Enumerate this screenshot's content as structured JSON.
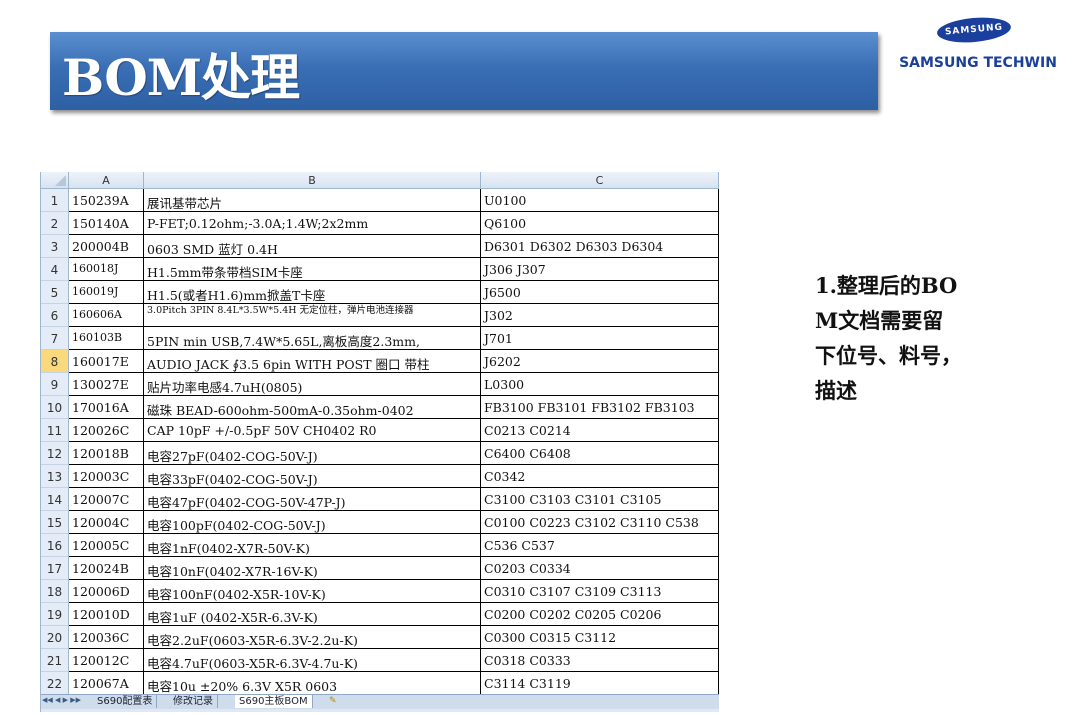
{
  "slide": {
    "title": "BOM处理",
    "logo": {
      "mark": "SAMSUNG",
      "text": "SAMSUNG TECHWIN"
    },
    "note_lines": [
      "1.整理后的BO",
      "M文档需要留",
      "下位号、料号，",
      "描述"
    ]
  },
  "spreadsheet": {
    "columns": [
      "A",
      "B",
      "C"
    ],
    "selected_row": 8,
    "rows": [
      {
        "n": "1",
        "a": "150239A",
        "b": "展讯基带芯片",
        "c": "U0100"
      },
      {
        "n": "2",
        "a": "150140A",
        "b": "P-FET;0.12ohm;-3.0A;1.4W;2x2mm",
        "c": "Q6100"
      },
      {
        "n": "3",
        "a": "200004B",
        "b": "0603 SMD 蓝灯 0.4H",
        "c": "D6301 D6302 D6303 D6304"
      },
      {
        "n": "4",
        "a": "160018J",
        "b": "H1.5mm带条带档SIM卡座",
        "c": "J306 J307"
      },
      {
        "n": "5",
        "a": "160019J",
        "b": "H1.5(或者H1.6)mm掀盖T卡座",
        "c": "J6500"
      },
      {
        "n": "6",
        "a": "160606A",
        "b": "3.0Pitch 3PIN 8.4L*3.5W*5.4H  无定位柱，弹片电池连接器",
        "c": "J302"
      },
      {
        "n": "7",
        "a": "160103B",
        "b": "5PIN min USB,7.4W*5.65L,离板高度2.3mm,",
        "c": "J701"
      },
      {
        "n": "8",
        "a": "160017E",
        "b": "AUDIO JACK ∮3.5 6pin  WITH POST 圈口 带柱",
        "c": "J6202"
      },
      {
        "n": "9",
        "a": "130027E",
        "b": "贴片功率电感4.7uH(0805)",
        "c": "L0300"
      },
      {
        "n": "10",
        "a": "170016A",
        "b": "磁珠 BEAD-600ohm-500mA-0.35ohm-0402",
        "c": "FB3100 FB3101 FB3102 FB3103"
      },
      {
        "n": "11",
        "a": "120026C",
        "b": "CAP 10pF +/-0.5pF 50V CH0402 R0",
        "c": "C0213 C0214"
      },
      {
        "n": "12",
        "a": "120018B",
        "b": "电容27pF(0402-COG-50V-J)",
        "c": "C6400 C6408"
      },
      {
        "n": "13",
        "a": "120003C",
        "b": "电容33pF(0402-COG-50V-J)",
        "c": "C0342"
      },
      {
        "n": "14",
        "a": "120007C",
        "b": "电容47pF(0402-COG-50V-47P-J)",
        "c": "C3100 C3103 C3101 C3105"
      },
      {
        "n": "15",
        "a": "120004C",
        "b": "电容100pF(0402-COG-50V-J)",
        "c": "C0100 C0223 C3102 C3110 C538"
      },
      {
        "n": "16",
        "a": "120005C",
        "b": "电容1nF(0402-X7R-50V-K)",
        "c": " C536 C537"
      },
      {
        "n": "17",
        "a": "120024B",
        "b": "电容10nF(0402-X7R-16V-K)",
        "c": "C0203 C0334"
      },
      {
        "n": "18",
        "a": "120006D",
        "b": "电容100nF(0402-X5R-10V-K)",
        "c": "C0310 C3107 C3109 C3113"
      },
      {
        "n": "19",
        "a": "120010D",
        "b": "电容1uF (0402-X5R-6.3V-K)",
        "c": "C0200 C0202 C0205 C0206"
      },
      {
        "n": "20",
        "a": "120036C",
        "b": "电容2.2uF(0603-X5R-6.3V-2.2u-K)",
        "c": "C0300 C0315 C3112"
      },
      {
        "n": "21",
        "a": "120012C",
        "b": "电容4.7uF(0603-X5R-6.3V-4.7u-K)",
        "c": "C0318 C0333"
      },
      {
        "n": "22",
        "a": "120067A",
        "b": "电容10u ±20% 6.3V X5R 0603",
        "c": "C3114 C3119"
      }
    ],
    "sheet_tabs": [
      "S690配置表",
      "修改记录",
      "S690主板BOM"
    ],
    "active_tab": 2
  }
}
